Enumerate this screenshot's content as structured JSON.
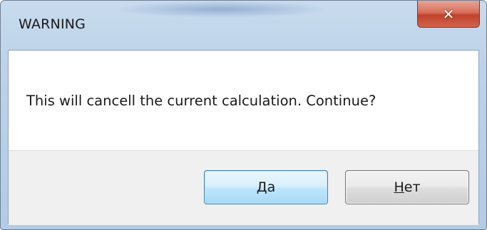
{
  "dialog": {
    "title": "WARNING",
    "message": "This will cancell the current calculation. Continue?",
    "close_icon": "close-icon",
    "buttons": {
      "yes_label": "Да",
      "no_label": "Нет"
    }
  }
}
